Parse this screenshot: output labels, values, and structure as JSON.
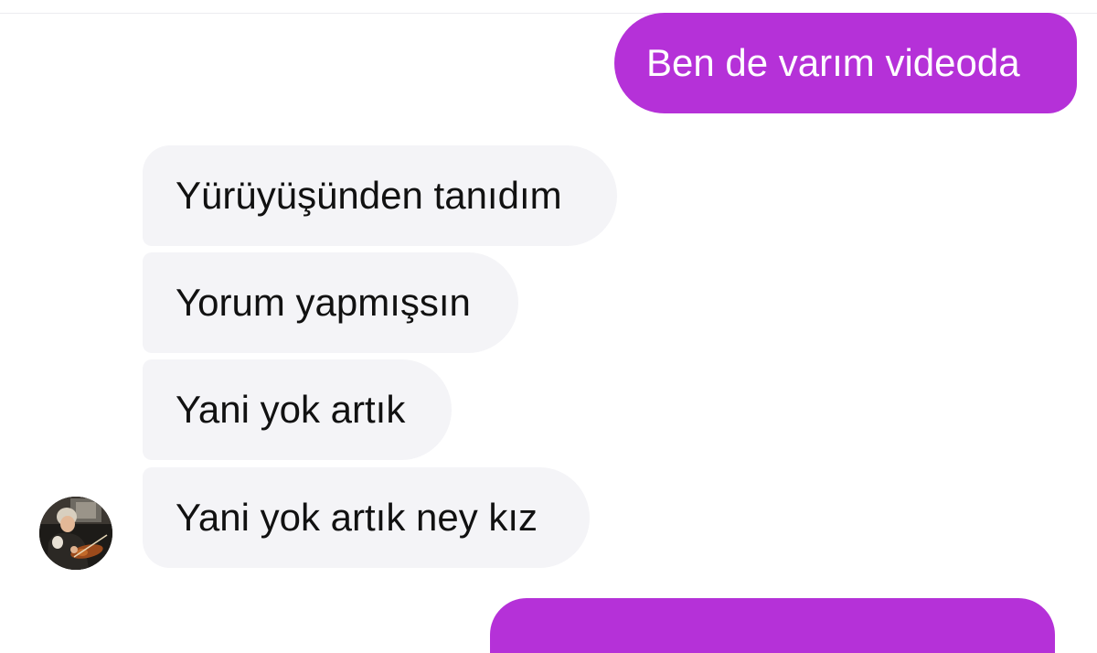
{
  "colors": {
    "outgoing_bubble": "#b531d8",
    "incoming_bubble": "#f4f4f7",
    "outgoing_text": "#ffffff",
    "incoming_text": "#111111"
  },
  "messages": [
    {
      "direction": "outgoing",
      "text": "Ben de varım videoda"
    },
    {
      "direction": "incoming",
      "text": "Yürüyüşünden tanıdım"
    },
    {
      "direction": "incoming",
      "text": "Yorum yapmışsın"
    },
    {
      "direction": "incoming",
      "text": "Yani yok artık"
    },
    {
      "direction": "incoming",
      "text": "Yani yok artık ney kız"
    }
  ],
  "sender": {
    "avatar_icon": "violinist-avatar-icon"
  }
}
